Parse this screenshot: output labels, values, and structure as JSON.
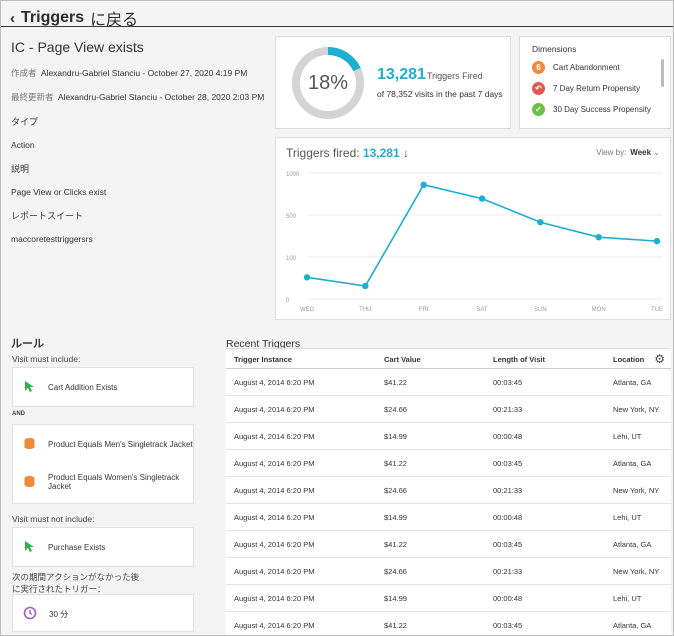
{
  "header": {
    "back_title": "Triggers",
    "back_suffix": "に戻る"
  },
  "detail": {
    "title": "IC - Page View exists",
    "created_label": "作成者",
    "created_value": "Alexandru-Gabriel Stanciu - October 27, 2020 4:19 PM",
    "updated_label": "最終更新者",
    "updated_value": "Alexandru-Gabriel Stanciu - October 28, 2020 2:03 PM",
    "type_label": "タイプ",
    "type_value": "Action",
    "desc_label": "説明",
    "desc_value": "Page View or Clicks exist",
    "suite_label": "レポートスイート",
    "suite_value": "maccoretesttriggersrs"
  },
  "summary": {
    "percent": "18%",
    "percent_value": 18,
    "triggers_count": "13,281",
    "triggers_label": "Triggers Fired",
    "visits_text": "of 78,352 visits in the past 7 days"
  },
  "dimensions": {
    "title": "Dimensions",
    "items": [
      {
        "label": "Cart Abandonment",
        "icon": "six-icon",
        "glyph": "6",
        "color": "#f08a3c"
      },
      {
        "label": "7 Day Return Propensity",
        "icon": "return-arrow-icon",
        "glyph": "↶",
        "color": "#e05a4f"
      },
      {
        "label": "30 Day Success Propensity",
        "icon": "checkmark-icon",
        "glyph": "✓",
        "color": "#6fbf4a"
      }
    ]
  },
  "chart_data": {
    "type": "line",
    "title": "Triggers fired:",
    "title_value": "13,281",
    "categories": [
      "WED",
      "THU",
      "FRI",
      "SAT",
      "SUN",
      "MON",
      "TUE"
    ],
    "values": [
      55,
      33,
      290,
      255,
      195,
      157,
      147
    ],
    "yticks": [
      "1000",
      "500",
      "100",
      "0"
    ],
    "ylim": [
      0,
      320
    ],
    "color": "#1eaed0",
    "grid": true,
    "view_by_label": "View by:",
    "view_by_value": "Week"
  },
  "rules": {
    "title": "ルール",
    "must_include": "Visit must include:",
    "cart_addition": "Cart Addition Exists",
    "and_label": "AND",
    "mens": "Product Equals Men's Singletrack Jacket",
    "womens": "Product Equals Women's Singletrack Jacket",
    "must_not_include": "Visit must not include:",
    "purchase": "Purchase Exists",
    "after_line1": "次の期間アクションがなかった後",
    "after_line2": "に実行されたトリガー：",
    "duration": "30 分"
  },
  "recent": {
    "title": "Recent Triggers",
    "columns": [
      "Trigger Instance",
      "Cart Value",
      "Length of Visit",
      "Location"
    ],
    "rows": [
      [
        "August 4, 2014  6:20 PM",
        "$41.22",
        "00:03:45",
        "Atlanta, GA"
      ],
      [
        "August 4, 2014  6:20 PM",
        "$24.66",
        "00:21:33",
        "New York, NY"
      ],
      [
        "August 4, 2014  6:20 PM",
        "$14.99",
        "00:00:48",
        "Lehi, UT"
      ],
      [
        "August 4, 2014  6:20 PM",
        "$41.22",
        "00:03:45",
        "Atlanta, GA"
      ],
      [
        "August 4, 2014  6:20 PM",
        "$24.66",
        "00:21:33",
        "New York, NY"
      ],
      [
        "August 4, 2014  6:20 PM",
        "$14.99",
        "00:00:48",
        "Lehi, UT"
      ],
      [
        "August 4, 2014  6:20 PM",
        "$41.22",
        "00:03:45",
        "Atlanta, GA"
      ],
      [
        "August 4, 2014  6:20 PM",
        "$24.66",
        "00:21:33",
        "New York, NY"
      ],
      [
        "August 4, 2014  6:20 PM",
        "$14.99",
        "00:00:48",
        "Lehi, UT"
      ],
      [
        "August 4, 2014  6:20 PM",
        "$41.22",
        "00:03:45",
        "Atlanta, GA"
      ]
    ]
  }
}
